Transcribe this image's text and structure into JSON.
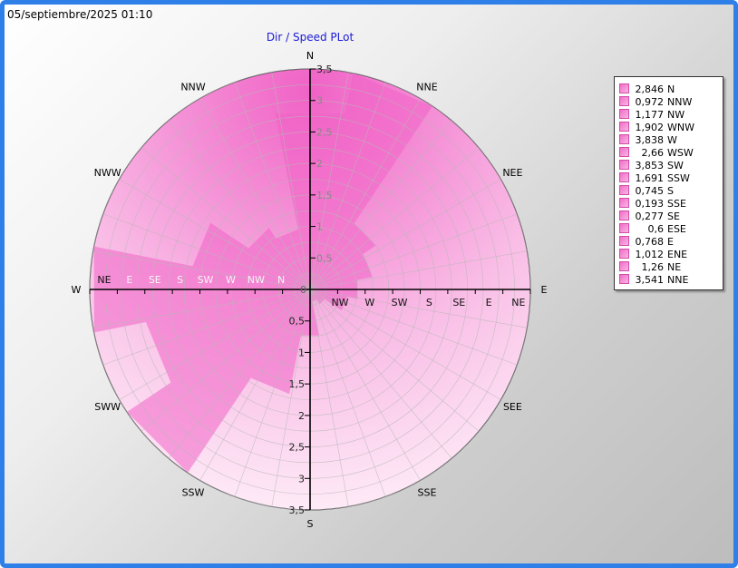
{
  "timestamp": "05/septiembre/2025 01:10",
  "colors": {
    "frame": "#2f7fe8",
    "title": "#1a1ad6",
    "fill_dark": "#f062c6",
    "fill_light": "#fff2fa",
    "grid": "#b8b8b8"
  },
  "chart_data": {
    "type": "polar-area",
    "title": "Dir / Speed PLot",
    "compass_labels": [
      "N",
      "NNE",
      "NEE",
      "E",
      "SEE",
      "SSE",
      "S",
      "SSW",
      "SWW",
      "W",
      "NWW",
      "NNW"
    ],
    "radial_ticks": [
      "0,5",
      "1",
      "1,5",
      "2",
      "2,5",
      "3",
      "3,5"
    ],
    "rmax": 3.5,
    "axis_labels": {
      "west": [
        "NE",
        "E",
        "SE",
        "S",
        "SW",
        "W",
        "NW",
        "N"
      ],
      "east": [
        "NW",
        "W",
        "SW",
        "S",
        "SE",
        "E",
        "NE"
      ],
      "top_zero": "0",
      "bottom_first": "0,5"
    },
    "series": [
      {
        "label": "N",
        "value": 2.846,
        "display": "2,846"
      },
      {
        "label": "NNW",
        "value": 0.972,
        "display": "0,972"
      },
      {
        "label": "NW",
        "value": 1.177,
        "display": "1,177"
      },
      {
        "label": "WNW",
        "value": 1.902,
        "display": "1,902"
      },
      {
        "label": "W",
        "value": 3.838,
        "display": "3,838"
      },
      {
        "label": "WSW",
        "value": 2.66,
        "display": "2,66"
      },
      {
        "label": "SW",
        "value": 3.853,
        "display": "3,853"
      },
      {
        "label": "SSW",
        "value": 1.691,
        "display": "1,691"
      },
      {
        "label": "S",
        "value": 0.745,
        "display": "0,745"
      },
      {
        "label": "SSE",
        "value": 0.193,
        "display": "0,193"
      },
      {
        "label": "SE",
        "value": 0.277,
        "display": "0,277"
      },
      {
        "label": "ESE",
        "value": 0.6,
        "display": "0,6"
      },
      {
        "label": "E",
        "value": 0.768,
        "display": "0,768"
      },
      {
        "label": "ENE",
        "value": 1.012,
        "display": "1,012"
      },
      {
        "label": "NE",
        "value": 1.26,
        "display": "1,26"
      },
      {
        "label": "NNE",
        "value": 3.541,
        "display": "3,541"
      }
    ]
  }
}
